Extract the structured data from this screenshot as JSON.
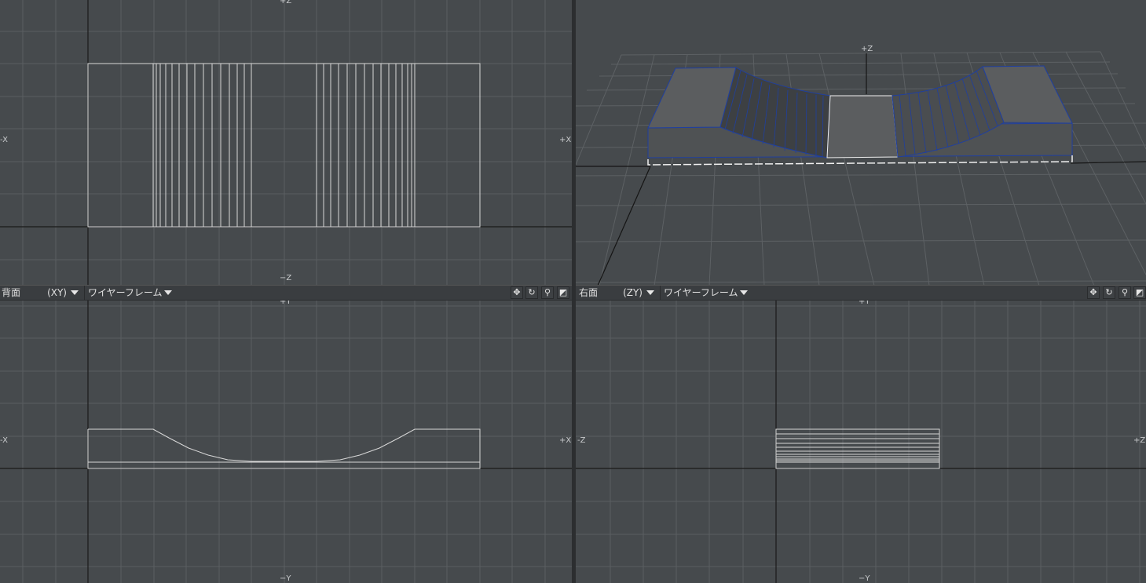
{
  "viewports": {
    "top": {
      "labels": {
        "top": "+Z",
        "bottom": "−Z",
        "left": "-X",
        "right": "+X"
      }
    },
    "perspective": {
      "labels": {
        "top": "+Z"
      }
    },
    "back": {
      "header": {
        "view": "背面",
        "code": "(XY)",
        "mode": "ワイヤーフレーム"
      },
      "labels": {
        "top": "+Y",
        "bottom": "−Y",
        "left": "-X",
        "right": "+X"
      }
    },
    "right": {
      "header": {
        "view": "右面",
        "code": "(ZY)",
        "mode": "ワイヤーフレーム"
      },
      "labels": {
        "top": "+Y",
        "bottom": "−Y",
        "left": "-Z",
        "right": "+Z"
      }
    }
  },
  "icons": [
    "move-view-icon",
    "rotate-view-icon",
    "zoom-view-icon",
    "maximize-view-icon"
  ],
  "colors": {
    "viewport_bg": "#464a4d",
    "grid": "#5a5e61",
    "axis": "#1a1a1a",
    "wire": "#d8d8d8",
    "selected_edge": "#1f3fa0",
    "solid_face": "#5a5c5e"
  }
}
